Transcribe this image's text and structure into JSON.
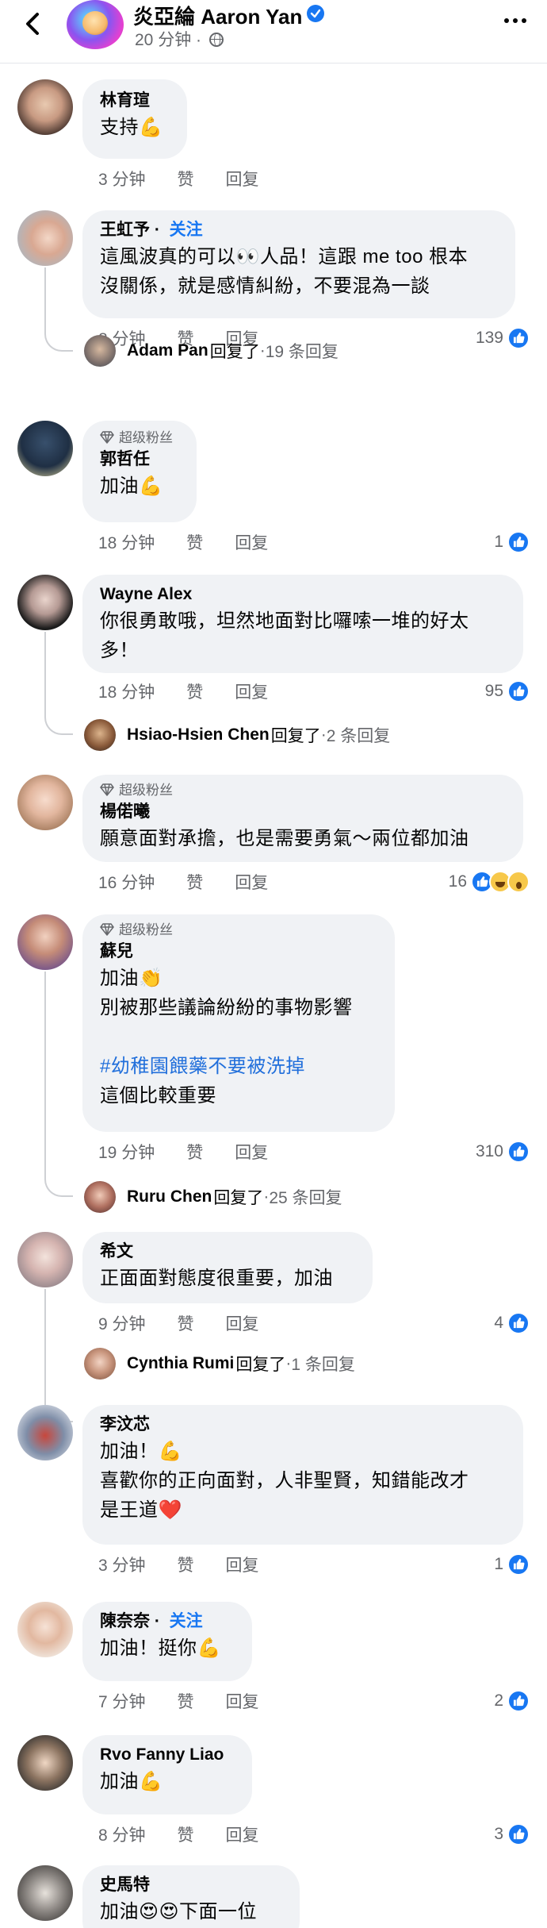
{
  "header": {
    "back_icon": "arrow-left-icon",
    "page_name": "炎亞綸 Aaron Yan",
    "time": "20 分钟",
    "separator": " · ",
    "more_icon": "more-dots-icon"
  },
  "ui": {
    "reply_label": "回复",
    "like_label": "赞",
    "fan_label": "超级粉丝",
    "follow_label": "关注",
    "replied_label": "回复了",
    "dot": " · "
  },
  "comments": [
    {
      "author": "林育瑄",
      "lines": [
        "支持💪"
      ],
      "time": "3 分钟",
      "reacts": ""
    },
    {
      "author": "王虹予",
      "follow": true,
      "lines": [
        "這風波真的可以👀人品！這跟 me too 根本",
        "沒關係，就是感情糾紛，不要混為一談"
      ],
      "time": "8 分钟",
      "reacts": "139",
      "reply": {
        "name": "Adam Pan",
        "count": "19 条回复"
      }
    },
    {
      "author": "郭哲任",
      "fan": true,
      "lines": [
        "加油💪"
      ],
      "time": "18 分钟",
      "reacts": "1"
    },
    {
      "author": "Wayne Alex",
      "lines": [
        "你很勇敢哦，坦然地面對比囉嗦一堆的好太",
        "多！"
      ],
      "time": "18 分钟",
      "reacts": "95",
      "reply": {
        "name": "Hsiao-Hsien Chen",
        "count": "2 条回复"
      }
    },
    {
      "author": "楊偌曦",
      "fan": true,
      "lines": [
        "願意面對承擔，也是需要勇氣～兩位都加油"
      ],
      "time": "16 分钟",
      "reacts": "16"
    },
    {
      "author": "蘇兒",
      "fan": true,
      "lines": [
        "加油👏",
        "別被那些議論紛紛的事物影響",
        "",
        "#幼稚園餵藥不要被洗掉",
        "這個比較重要"
      ],
      "time": "19 分钟",
      "reacts": "310",
      "reply": {
        "name": "Ruru Chen",
        "count": "25 条回复"
      }
    },
    {
      "author": "希文",
      "lines": [
        "正面面對態度很重要，加油"
      ],
      "time": "9 分钟",
      "reacts": "4",
      "reply": {
        "name": "Cynthia Rumi",
        "count": "1 条回复"
      }
    },
    {
      "author": "李汶芯",
      "lines": [
        "加油！💪",
        "喜歡你的正向面對，人非聖賢，知錯能改才",
        "是王道❤️"
      ],
      "time": "3 分钟",
      "reacts": "1"
    },
    {
      "author": "陳奈奈",
      "follow": true,
      "lines": [
        "加油！挺你💪"
      ],
      "time": "7 分钟",
      "reacts": "2"
    },
    {
      "author": "Rvo Fanny Liao",
      "lines": [
        "加油💪"
      ],
      "time": "8 分钟",
      "reacts": "3"
    },
    {
      "author": "史馬特",
      "lines": [
        "加油😍😍下面一位"
      ],
      "time": "",
      "reacts": ""
    }
  ],
  "colors": {
    "accent": "#1877f2",
    "bubble": "#f0f2f5",
    "meta": "#65676b"
  }
}
